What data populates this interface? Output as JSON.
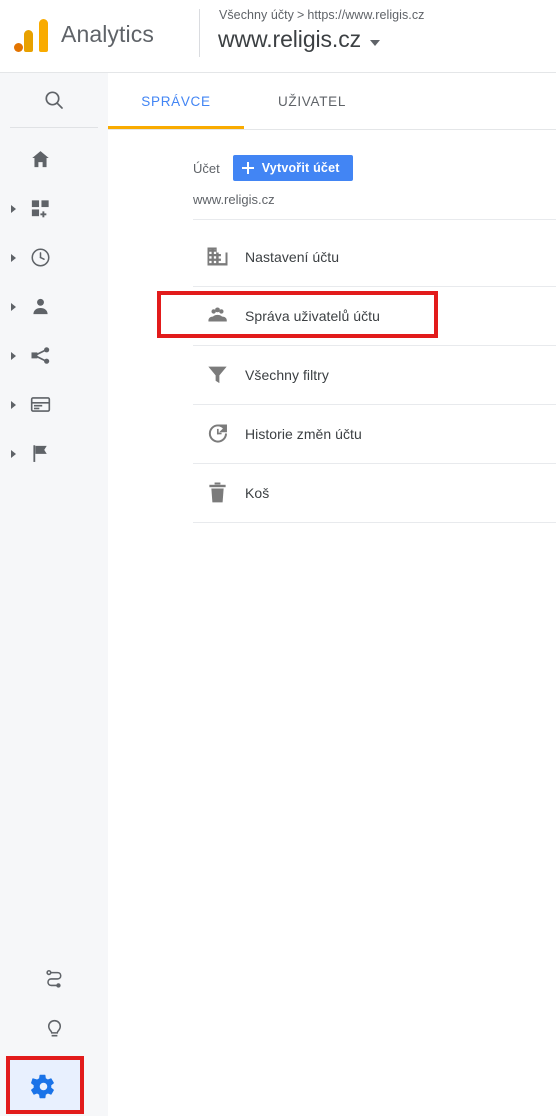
{
  "header": {
    "brand": "Analytics",
    "logo_icon": "google-analytics-logo",
    "logo_colors": {
      "dot": "#e37400",
      "mid": "#e8a100",
      "tall": "#f9ab00"
    },
    "breadcrumb": {
      "account": "Všechny účty",
      "separator": ">",
      "property": "https://www.religis.cz"
    },
    "property_title": "www.religis.cz",
    "property_dropdown_icon": "caret-down-icon"
  },
  "rail": {
    "search_icon": "search-icon",
    "items": [
      {
        "icon": "home-icon",
        "expandable": false
      },
      {
        "icon": "customization-icon",
        "expandable": true
      },
      {
        "icon": "realtime-clock-icon",
        "expandable": true
      },
      {
        "icon": "audience-person-icon",
        "expandable": true
      },
      {
        "icon": "acquisition-share-icon",
        "expandable": true
      },
      {
        "icon": "behavior-window-icon",
        "expandable": true
      },
      {
        "icon": "conversions-flag-icon",
        "expandable": true
      }
    ],
    "bottom_items": [
      {
        "icon": "attribution-path-icon",
        "name": "attribution"
      },
      {
        "icon": "discover-bulb-icon",
        "name": "discover"
      },
      {
        "icon": "admin-gear-icon",
        "name": "admin",
        "selected": true,
        "highlighted": true
      }
    ],
    "highlight_color": "#e21b1b",
    "selected_bg": "#e8f0fe",
    "selected_icon_color": "#1a73e8"
  },
  "tabs": {
    "items": [
      {
        "label": "SPRÁVCE",
        "active": true
      },
      {
        "label": "UŽIVATEL",
        "active": false
      }
    ],
    "active_text_color": "#4285f4",
    "underline_color": "#f9ab00"
  },
  "main": {
    "account_label": "Účet",
    "create_button": {
      "label": "Vytvořit účet",
      "icon": "plus-icon",
      "color": "#4285f4"
    },
    "account_name": "www.religis.cz",
    "menu_items": [
      {
        "label": "Nastavení účtu",
        "icon": "building-icon",
        "highlighted": false
      },
      {
        "label": "Správa uživatelů účtu",
        "icon": "people-group-icon",
        "highlighted": true
      },
      {
        "label": "Všechny filtry",
        "icon": "funnel-icon",
        "highlighted": false
      },
      {
        "label": "Historie změn účtu",
        "icon": "history-restore-icon",
        "highlighted": false
      },
      {
        "label": "Koš",
        "icon": "trash-icon",
        "highlighted": false
      }
    ],
    "highlight_color": "#e21b1b"
  }
}
